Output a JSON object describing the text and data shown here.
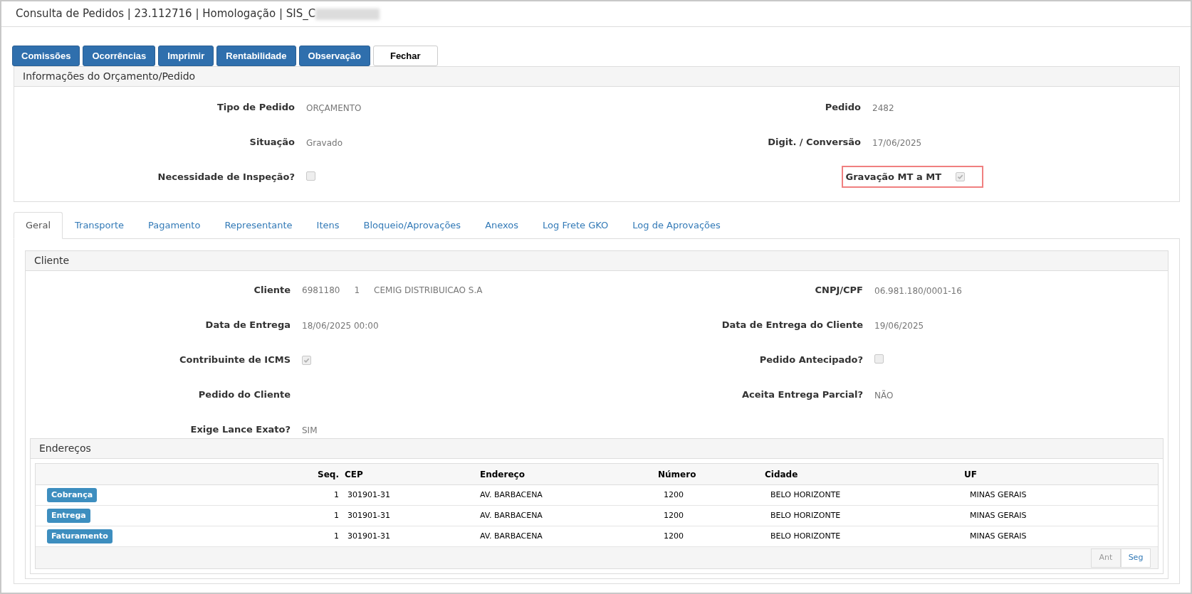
{
  "window": {
    "title": "Consulta de Pedidos | 23.112716 | Homologação | SIS_C",
    "title_redacted": true
  },
  "toolbar": [
    {
      "label": "Comissões",
      "kind": "primary"
    },
    {
      "label": "Ocorrências",
      "kind": "primary"
    },
    {
      "label": "Imprimir",
      "kind": "primary"
    },
    {
      "label": "Rentabilidade",
      "kind": "primary"
    },
    {
      "label": "Observação",
      "kind": "primary"
    },
    {
      "label": "Fechar",
      "kind": "default"
    }
  ],
  "order_panel": {
    "title": "Informações do Orçamento/Pedido",
    "rows": [
      [
        {
          "label": "Tipo de Pedido",
          "kind": "text",
          "value": "ORÇAMENTO"
        },
        {
          "label": "Pedido",
          "kind": "text",
          "value": "2482"
        }
      ],
      [
        {
          "label": "Situação",
          "kind": "text",
          "value": "Gravado"
        },
        {
          "label": "Digit. / Conversão",
          "kind": "text",
          "value": "17/06/2025"
        }
      ],
      [
        {
          "label": "Necessidade de Inspeção?",
          "kind": "checkbox",
          "checked": false,
          "highlighted": false
        },
        {
          "label": "Gravação MT a MT",
          "kind": "checkbox",
          "checked": true,
          "highlighted": true
        }
      ]
    ]
  },
  "tabs": [
    {
      "label": "Geral",
      "selected": true
    },
    {
      "label": "Transporte",
      "selected": false
    },
    {
      "label": "Pagamento",
      "selected": false
    },
    {
      "label": "Representante",
      "selected": false
    },
    {
      "label": "Itens",
      "selected": false
    },
    {
      "label": "Bloqueio/Aprovações",
      "selected": false
    },
    {
      "label": "Anexos",
      "selected": false
    },
    {
      "label": "Log Frete GKO",
      "selected": false
    },
    {
      "label": "Log de Aprovações",
      "selected": false
    }
  ],
  "client_panel": {
    "title": "Cliente",
    "rows": [
      [
        {
          "label": "Cliente",
          "kind": "multi",
          "values": [
            "6981180",
            "1",
            "CEMIG DISTRIBUICAO S.A"
          ]
        },
        {
          "label": "CNPJ/CPF",
          "kind": "text",
          "value": "06.981.180/0001-16"
        }
      ],
      [
        {
          "label": "Data de Entrega",
          "kind": "text",
          "value": "18/06/2025 00:00"
        },
        {
          "label": "Data de Entrega do Cliente",
          "kind": "text",
          "value": "19/06/2025"
        }
      ],
      [
        {
          "label": "Contribuinte de ICMS",
          "kind": "checkbox",
          "checked": true,
          "highlighted": false
        },
        {
          "label": "Pedido Antecipado?",
          "kind": "checkbox",
          "checked": false,
          "highlighted": false
        }
      ],
      [
        {
          "label": "Pedido do Cliente",
          "kind": "text"
        },
        {
          "label": "Aceita Entrega Parcial?",
          "kind": "text",
          "value": "NÃO"
        }
      ],
      [
        {
          "label": "Exige Lance Exato?",
          "kind": "text",
          "value": "SIM"
        }
      ]
    ]
  },
  "addresses": {
    "title": "Endereços",
    "columns": [
      "Seq.",
      "CEP",
      "Endereço",
      "Número",
      "Cidade",
      "UF"
    ],
    "rows": [
      {
        "type": "Cobrança",
        "cells": [
          "1",
          "301901-31",
          "AV. BARBACENA",
          "1200",
          "BELO HORIZONTE",
          "MINAS GERAIS"
        ]
      },
      {
        "type": "Entrega",
        "cells": [
          "1",
          "301901-31",
          "AV. BARBACENA",
          "1200",
          "BELO HORIZONTE",
          "MINAS GERAIS"
        ]
      },
      {
        "type": "Faturamento",
        "cells": [
          "1",
          "301901-31",
          "AV. BARBACENA",
          "1200",
          "BELO HORIZONTE",
          "MINAS GERAIS"
        ]
      }
    ],
    "pager": [
      {
        "label": "Ant",
        "disabled": true
      },
      {
        "label": "Seg",
        "disabled": false
      }
    ]
  }
}
